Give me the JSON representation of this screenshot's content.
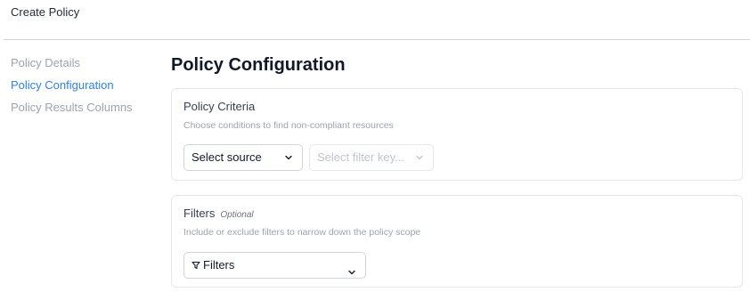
{
  "header": {
    "title": "Create Policy"
  },
  "sidebar": {
    "items": [
      {
        "label": "Policy Details",
        "active": false
      },
      {
        "label": "Policy Configuration",
        "active": true
      },
      {
        "label": "Policy Results Columns",
        "active": false
      }
    ]
  },
  "main": {
    "title": "Policy Configuration",
    "criteria": {
      "title": "Policy Criteria",
      "subtitle": "Choose conditions to find non-compliant resources",
      "source_select": {
        "value": "Select source",
        "icon": "chevron-down-icon"
      },
      "filter_key_select": {
        "placeholder": "Select filter key...",
        "disabled": true,
        "icon": "chevron-down-icon"
      }
    },
    "filters": {
      "title": "Filters",
      "optional_label": "Optional",
      "subtitle": "Include or exclude filters to narrow down the policy scope",
      "button": {
        "label": "Filters",
        "icon": "funnel-icon",
        "chevron": "chevron-down-icon"
      }
    }
  },
  "colors": {
    "accent": "#2f80ed",
    "muted_text": "#9ca3af",
    "border": "#e5e7eb",
    "heading": "#111827"
  }
}
